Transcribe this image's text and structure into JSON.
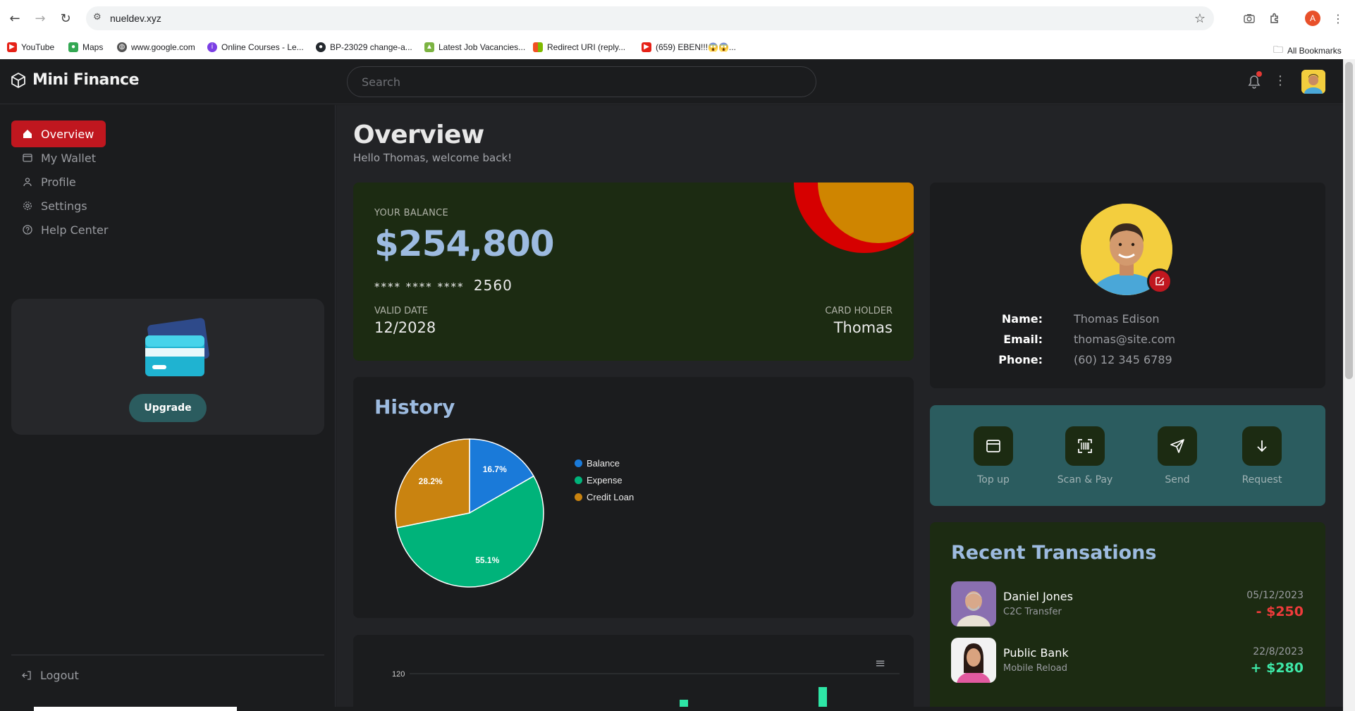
{
  "browser": {
    "url": "nueldev.xyz",
    "profile_initial": "A",
    "bookmarks": [
      {
        "label": "YouTube",
        "color": "#e62117"
      },
      {
        "label": "Maps",
        "color": "#34a853"
      },
      {
        "label": "www.google.com",
        "color": "#555555"
      },
      {
        "label": "Online Courses - Le...",
        "color": "#7b3fe4"
      },
      {
        "label": "BP-23029 change-a...",
        "color": "#24292e"
      },
      {
        "label": "Latest Job Vacancies...",
        "color": "#7cb342"
      },
      {
        "label": "Redirect URI (reply...",
        "color": "#f25022"
      },
      {
        "label": "(659) EBEN!!!😱😱...",
        "color": "#e62117"
      }
    ],
    "all_bookmarks_label": "All Bookmarks"
  },
  "app": {
    "name": "Mini Finance",
    "search_placeholder": "Search"
  },
  "sidebar": {
    "items": [
      {
        "label": "Overview",
        "icon": "home-icon",
        "active": true
      },
      {
        "label": "My Wallet",
        "icon": "wallet-icon",
        "active": false
      },
      {
        "label": "Profile",
        "icon": "user-icon",
        "active": false
      },
      {
        "label": "Settings",
        "icon": "gear-icon",
        "active": false
      },
      {
        "label": "Help Center",
        "icon": "help-icon",
        "active": false
      }
    ],
    "upgrade_label": "Upgrade",
    "logout_label": "Logout"
  },
  "overview": {
    "title": "Overview",
    "subtitle": "Hello Thomas, welcome back!"
  },
  "balance": {
    "label": "YOUR BALANCE",
    "amount": "$254,800",
    "card_masked": "**** **** ****",
    "card_last4": "2560",
    "valid_label": "VALID DATE",
    "valid_value": "12/2028",
    "holder_label": "CARD HOLDER",
    "holder_value": "Thomas"
  },
  "history": {
    "title": "History"
  },
  "chart_data": {
    "type": "pie",
    "series": [
      {
        "name": "Balance",
        "value": 16.7,
        "color": "#1a7ad9"
      },
      {
        "name": "Expense",
        "value": 55.1,
        "color": "#00b37a"
      },
      {
        "name": "Credit Loan",
        "value": 28.2,
        "color": "#c98310"
      }
    ],
    "labels": [
      "16.7%",
      "55.1%",
      "28.2%"
    ],
    "legend_position": "right"
  },
  "bar_chart": {
    "y_tick": "120"
  },
  "profile": {
    "name_label": "Name:",
    "name_value": "Thomas Edison",
    "email_label": "Email:",
    "email_value": "thomas@site.com",
    "phone_label": "Phone:",
    "phone_value": "(60) 12 345 6789"
  },
  "actions": [
    {
      "label": "Top up",
      "icon": "wallet-icon"
    },
    {
      "label": "Scan & Pay",
      "icon": "barcode-scan-icon"
    },
    {
      "label": "Send",
      "icon": "send-icon"
    },
    {
      "label": "Request",
      "icon": "arrow-down-icon"
    }
  ],
  "transactions": {
    "title": "Recent Transations",
    "items": [
      {
        "name": "Daniel Jones",
        "type": "C2C Transfer",
        "date": "05/12/2023",
        "amount": "- $250",
        "color": "#ef3b3b"
      },
      {
        "name": "Public Bank",
        "type": "Mobile Reload",
        "date": "22/8/2023",
        "amount": "+ $280",
        "color": "#3ee8a8"
      }
    ]
  },
  "colors": {
    "accent_red": "#c0171f",
    "balance_card_bg": "#1c2b12",
    "teal_card_bg": "#2b5c5f",
    "heading_blue": "#9dbbe0"
  }
}
